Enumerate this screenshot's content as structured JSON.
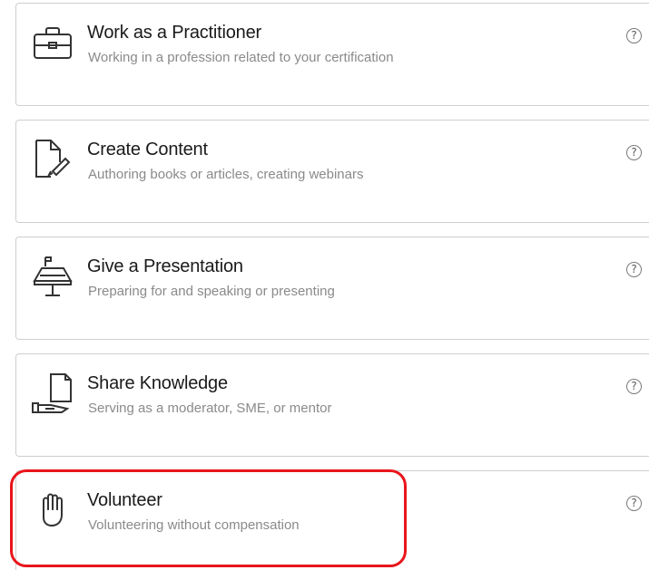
{
  "activities": [
    {
      "title": "Work as a Practitioner",
      "subtitle": "Working in a profession related to your certification",
      "help": "?",
      "icon": "briefcase-icon"
    },
    {
      "title": "Create Content",
      "subtitle": "Authoring books or articles, creating webinars",
      "help": "?",
      "icon": "document-pencil-icon"
    },
    {
      "title": "Give a Presentation",
      "subtitle": "Preparing for and speaking or presenting",
      "help": "?",
      "icon": "podium-icon"
    },
    {
      "title": "Share Knowledge",
      "subtitle": "Serving as a moderator, SME, or mentor",
      "help": "?",
      "icon": "hand-document-icon"
    },
    {
      "title": "Volunteer",
      "subtitle": "Volunteering without compensation",
      "help": "?",
      "icon": "raised-hand-icon"
    }
  ],
  "highlight_color": "#e8151b",
  "highlighted_item": "Volunteer"
}
